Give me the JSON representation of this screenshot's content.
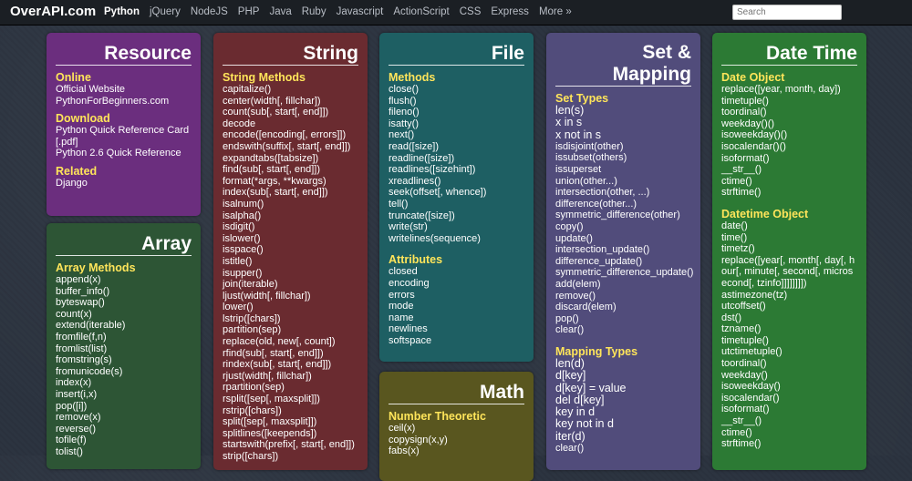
{
  "header": {
    "logo": "OverAPI.com",
    "nav": [
      "Python",
      "jQuery",
      "NodeJS",
      "PHP",
      "Java",
      "Ruby",
      "Javascript",
      "ActionScript",
      "CSS",
      "Express",
      "More »"
    ],
    "search_placeholder": "Search"
  },
  "resource": {
    "title": "Resource",
    "online_title": "Online",
    "online": [
      "Official Website",
      "PythonForBeginners.com"
    ],
    "download_title": "Download",
    "download": [
      "Python Quick Reference Card",
      "[.pdf]",
      "Python 2.6 Quick Reference"
    ],
    "related_title": "Related",
    "related": [
      "Django"
    ]
  },
  "array": {
    "title": "Array",
    "methods_title": "Array Methods",
    "methods": [
      "append(x)",
      "buffer_info()",
      "byteswap()",
      "count(x)",
      "extend(iterable)",
      "fromfile(f,n)",
      "fromlist(list)",
      "fromstring(s)",
      "fromunicode(s)",
      "index(x)",
      "insert(i,x)",
      "pop([i])",
      "remove(x)",
      "reverse()",
      "tofile(f)",
      "tolist()"
    ]
  },
  "string": {
    "title": "String",
    "methods_title": "String Methods",
    "methods": [
      "capitalize()",
      "center(width[, fillchar])",
      "count(sub[, start[, end]])",
      "decode",
      "encode([encoding[, errors]])",
      "endswith(suffix[, start[, end]])",
      "expandtabs([tabsize])",
      "find(sub[, start[, end]])",
      "format(*args, **kwargs)",
      "index(sub[, start[, end]])",
      "isalnum()",
      "isalpha()",
      "isdigit()",
      "islower()",
      "isspace()",
      "istitle()",
      "isupper()",
      "join(iterable)",
      "ljust(width[, fillchar])",
      "lower()",
      "lstrip([chars])",
      "partition(sep)",
      "replace(old, new[, count])",
      "rfind(sub[, start[, end]])",
      "rindex(sub[, start[, end]])",
      "rjust(width[, fillchar])",
      "rpartition(sep)",
      "rsplit([sep[, maxsplit]])",
      "rstrip([chars])",
      "split([sep[, maxsplit]])",
      "splitlines([keepends])",
      "startswith(prefix[, start[, end]])",
      "strip([chars])"
    ]
  },
  "file": {
    "title": "File",
    "methods_title": "Methods",
    "methods": [
      "close()",
      "flush()",
      "fileno()",
      "isatty()",
      "next()",
      "read([size])",
      "readline([size])",
      "readlines([sizehint])",
      "xreadlines()",
      "seek(offset[, whence])",
      "tell()",
      "truncate([size])",
      "write(str)",
      "writelines(sequence)"
    ],
    "attributes_title": "Attributes",
    "attributes": [
      "closed",
      "encoding",
      "errors",
      "mode",
      "name",
      "newlines",
      "softspace"
    ]
  },
  "math": {
    "title": "Math",
    "number_title": "Number Theoretic",
    "number": [
      "ceil(x)",
      "copysign(x,y)",
      "fabs(x)"
    ]
  },
  "set": {
    "title_line1": "Set &",
    "title_line2": "Mapping",
    "set_types_title": "Set Types",
    "set_types_ops": [
      "len(s)",
      "x in s",
      "x not in s"
    ],
    "set_types": [
      "isdisjoint(other)",
      "issubset(others)",
      "issuperset",
      "union(other...)",
      "intersection(other, ...)",
      "difference(other...)",
      "symmetric_difference(other)",
      "copy()",
      "update()",
      "intersection_update()",
      "difference_update()",
      "symmetric_difference_update()",
      "add(elem)",
      "remove()",
      "discard(elem)",
      "pop()",
      "clear()"
    ],
    "mapping_title": "Mapping Types",
    "mapping_ops": [
      "len(d)",
      "d[key]",
      "d[key] = value",
      "del d[key]",
      "key in d",
      "key not in d",
      "iter(d)"
    ],
    "mapping": [
      "clear()"
    ]
  },
  "date": {
    "title": "Date Time",
    "date_obj_title": "Date Object",
    "date_obj": [
      "replace([year, month, day])",
      "timetuple()",
      "toordinal()",
      "weekday()()",
      "isoweekday()()",
      "isocalendar()()",
      "isoformat()",
      "__str__()",
      "ctime()",
      "strftime()"
    ],
    "datetime_obj_title": "Datetime Object",
    "datetime_obj": [
      "date()",
      "time()",
      "timetz()",
      "replace([year[, month[, day[, hour[, minute[, second[, microsecond[, tzinfo]]]]]]]])",
      "astimezone(tz)",
      "utcoffset()",
      "dst()",
      "tzname()",
      "timetuple()",
      "utctimetuple()",
      "toordinal()",
      "weekday()",
      "isoweekday()",
      "isocalendar()",
      "isoformat()",
      "__str__()",
      "ctime()",
      "strftime()"
    ]
  }
}
